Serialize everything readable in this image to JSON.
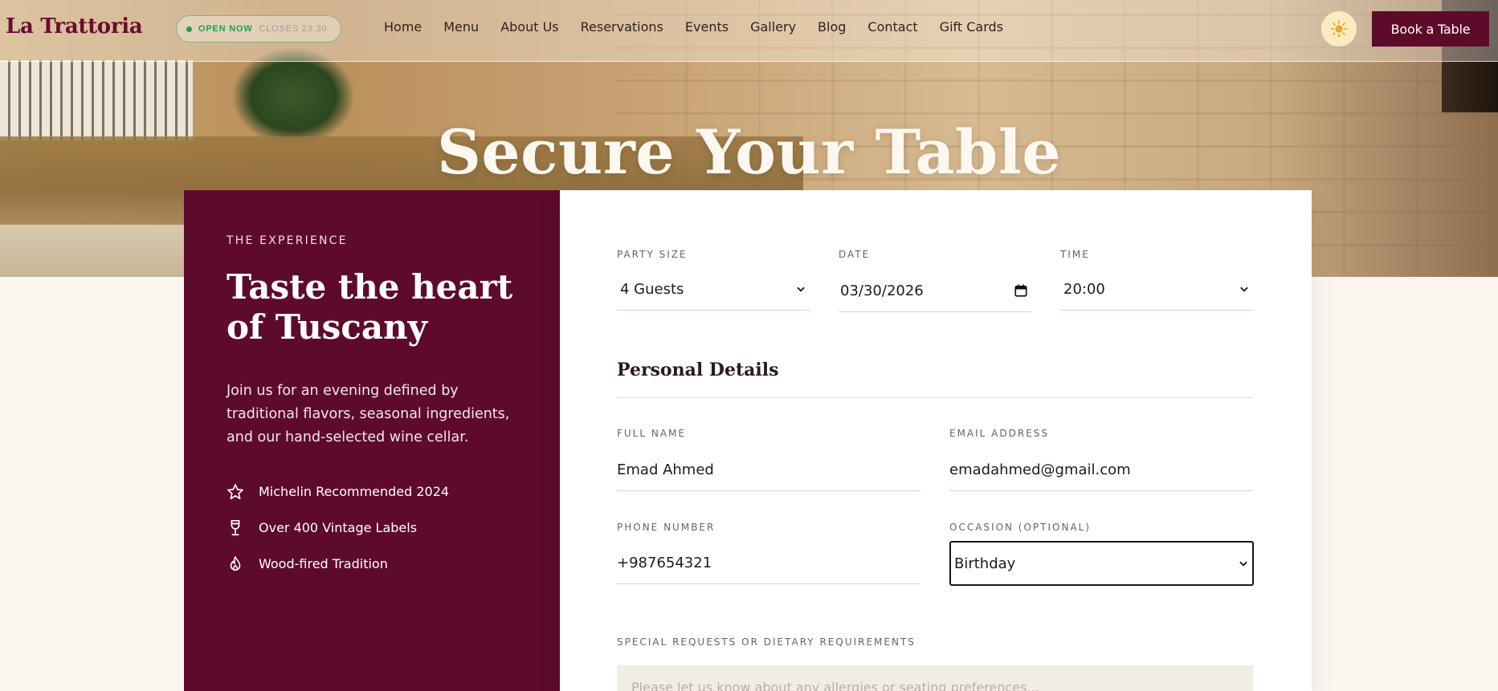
{
  "brand": {
    "name": "La Trattoria"
  },
  "status": {
    "open": "OPEN NOW",
    "closes": "CLOSES 23:30"
  },
  "nav": {
    "links": [
      "Home",
      "Menu",
      "About Us",
      "Reservations",
      "Events",
      "Gallery",
      "Blog",
      "Contact",
      "Gift Cards"
    ],
    "theme_icon": "sun-icon",
    "cta": "Book a Table"
  },
  "hero": {
    "title": "Secure Your Table"
  },
  "experience": {
    "eyebrow": "THE EXPERIENCE",
    "heading": "Taste the heart of Tuscany",
    "description": "Join us for an evening defined by traditional flavors, seasonal ingredients, and our hand-selected wine cellar.",
    "features": [
      {
        "icon": "star-icon",
        "label": "Michelin Recommended 2024"
      },
      {
        "icon": "wine-glass-icon",
        "label": "Over 400 Vintage Labels"
      },
      {
        "icon": "flame-icon",
        "label": "Wood-fired Tradition"
      }
    ]
  },
  "form": {
    "party_size": {
      "label": "PARTY SIZE",
      "value": "4 Guests"
    },
    "date": {
      "label": "DATE",
      "value": "03/30/2026"
    },
    "time": {
      "label": "TIME",
      "value": "20:00"
    },
    "section_title": "Personal Details",
    "full_name": {
      "label": "FULL NAME",
      "value": "Emad Ahmed"
    },
    "email": {
      "label": "EMAIL ADDRESS",
      "value": "emadahmed@gmail.com"
    },
    "phone": {
      "label": "PHONE NUMBER",
      "value": "+987654321"
    },
    "occasion": {
      "label": "OCCASION (OPTIONAL)",
      "value": "Birthday"
    },
    "requests": {
      "label": "SPECIAL REQUESTS OR DIETARY REQUIREMENTS",
      "placeholder": "Please let us know about any allergies or seating preferences..."
    }
  },
  "colors": {
    "brand": "#5e0a2c",
    "accent_green": "#1f9d55",
    "card": "#ffffff",
    "cream": "#faf6ef"
  }
}
